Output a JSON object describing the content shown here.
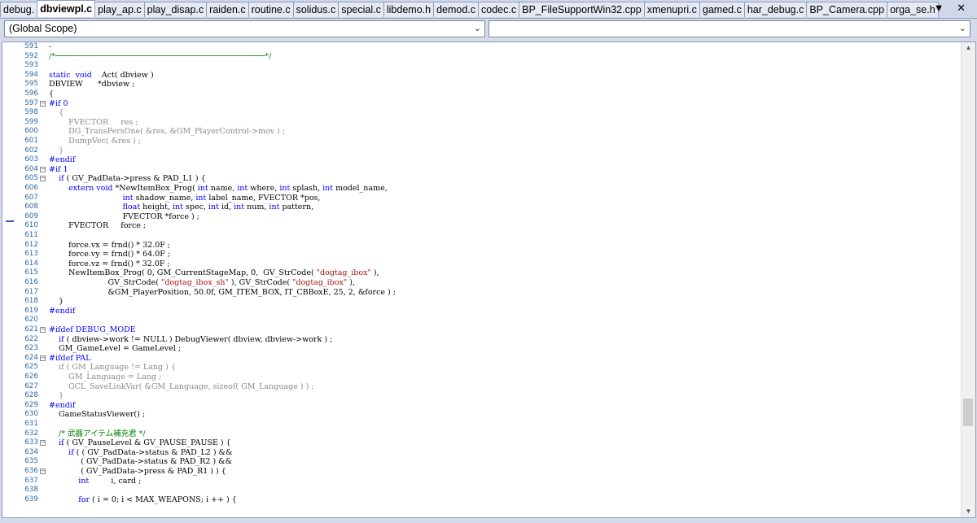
{
  "tabs": [
    {
      "label": "debug.",
      "active": false
    },
    {
      "label": "dbviewpl.c",
      "active": true
    },
    {
      "label": "play_ap.c",
      "active": false
    },
    {
      "label": "play_disap.c",
      "active": false
    },
    {
      "label": "raiden.c",
      "active": false
    },
    {
      "label": "routine.c",
      "active": false
    },
    {
      "label": "solidus.c",
      "active": false
    },
    {
      "label": "special.c",
      "active": false
    },
    {
      "label": "libdemo.h",
      "active": false
    },
    {
      "label": "demod.c",
      "active": false
    },
    {
      "label": "codec.c",
      "active": false
    },
    {
      "label": "BP_FileSupportWin32.cpp",
      "active": false
    },
    {
      "label": "xmenupri.c",
      "active": false
    },
    {
      "label": "gamed.c",
      "active": false
    },
    {
      "label": "har_debug.c",
      "active": false
    },
    {
      "label": "BP_Camera.cpp",
      "active": false
    },
    {
      "label": "orga_se.h",
      "active": false
    }
  ],
  "tab_controls": {
    "dropdown_icon": "▼",
    "close_icon": "✕"
  },
  "scope": {
    "left_value": "(Global Scope)",
    "right_value": ""
  },
  "code_lines": [
    {
      "n": "591",
      "t": "-",
      "fold": ""
    },
    {
      "n": "592",
      "t": "/*─────────────────────────────────────────────*/",
      "fold": "",
      "c": "cm"
    },
    {
      "n": "593",
      "t": "",
      "fold": ""
    },
    {
      "n": "594",
      "t": "static  void    Act( dbview )",
      "fold": "",
      "segs": [
        [
          "static",
          "kw"
        ],
        [
          "  ",
          ""
        ],
        [
          "void",
          "kw"
        ],
        [
          "    Act( dbview )",
          ""
        ]
      ]
    },
    {
      "n": "595",
      "t": "DBVIEW      *dbview ;",
      "fold": ""
    },
    {
      "n": "596",
      "t": "{",
      "fold": ""
    },
    {
      "n": "597",
      "t": "#if 0",
      "fold": "-",
      "c": "pp"
    },
    {
      "n": "598",
      "t": "    {",
      "fold": "",
      "c": "dim"
    },
    {
      "n": "599",
      "t": "        FVECTOR     res ;",
      "fold": "",
      "c": "dim"
    },
    {
      "n": "600",
      "t": "        DG_TransPersOne( &res, &GM_PlayerControl->mov ) ;",
      "fold": "",
      "c": "dim"
    },
    {
      "n": "601",
      "t": "        DumpVec( &res ) ;",
      "fold": "",
      "c": "dim"
    },
    {
      "n": "602",
      "t": "    }",
      "fold": "",
      "c": "dim"
    },
    {
      "n": "603",
      "t": "#endif",
      "fold": "",
      "c": "pp"
    },
    {
      "n": "604",
      "t": "#if 1",
      "fold": "-",
      "c": "pp"
    },
    {
      "n": "605",
      "t": "    if ( GV_PadData->press & PAD_L1 ) {",
      "fold": "-",
      "segs": [
        [
          "    ",
          ""
        ],
        [
          "if",
          "kw"
        ],
        [
          " ( GV_PadData->press & PAD_L1 ) {",
          ""
        ]
      ]
    },
    {
      "n": "606",
      "t": "        extern void *NewItemBox_Prog( int name, int where, int splash, int model_name,",
      "fold": "",
      "segs": [
        [
          "        ",
          ""
        ],
        [
          "extern void",
          "kw"
        ],
        [
          " *NewItemBox_Prog( ",
          ""
        ],
        [
          "int",
          "kw"
        ],
        [
          " name, ",
          ""
        ],
        [
          "int",
          "kw"
        ],
        [
          " where, ",
          ""
        ],
        [
          "int",
          "kw"
        ],
        [
          " splash, ",
          ""
        ],
        [
          "int",
          "kw"
        ],
        [
          " model_name,",
          ""
        ]
      ]
    },
    {
      "n": "607",
      "t": "                              int shadow_name, int label_name, FVECTOR *pos,",
      "fold": "",
      "segs": [
        [
          "                              ",
          ""
        ],
        [
          "int",
          "kw"
        ],
        [
          " shadow_name, ",
          ""
        ],
        [
          "int",
          "kw"
        ],
        [
          " label_name, FVECTOR *pos,",
          ""
        ]
      ]
    },
    {
      "n": "608",
      "t": "                              float height, int spec, int id, int num, int pattern,",
      "fold": "",
      "segs": [
        [
          "                              ",
          ""
        ],
        [
          "float",
          "kw"
        ],
        [
          " height, ",
          ""
        ],
        [
          "int",
          "kw"
        ],
        [
          " spec, ",
          ""
        ],
        [
          "int",
          "kw"
        ],
        [
          " id, ",
          ""
        ],
        [
          "int",
          "kw"
        ],
        [
          " num, ",
          ""
        ],
        [
          "int",
          "kw"
        ],
        [
          " pattern,",
          ""
        ]
      ]
    },
    {
      "n": "609",
      "t": "                              FVECTOR *force ) ;",
      "fold": ""
    },
    {
      "n": "610",
      "t": "        FVECTOR     force ;",
      "fold": ""
    },
    {
      "n": "611",
      "t": "",
      "fold": ""
    },
    {
      "n": "612",
      "t": "        force.vx = frnd() * 32.0F ;",
      "fold": ""
    },
    {
      "n": "613",
      "t": "        force.vy = frnd() * 64.0F ;",
      "fold": ""
    },
    {
      "n": "614",
      "t": "        force.vz = frnd() * 32.0F ;",
      "fold": ""
    },
    {
      "n": "615",
      "t": "        NewItemBox_Prog( 0, GM_CurrentStageMap, 0,  GV_StrCode( \"dogtag_ibox\" ),",
      "fold": "",
      "segs": [
        [
          "        NewItemBox_Prog( 0, GM_CurrentStageMap, 0,  GV_StrCode( ",
          ""
        ],
        [
          "\"dogtag_ibox\"",
          "st"
        ],
        [
          " ),",
          ""
        ]
      ]
    },
    {
      "n": "616",
      "t": "                        GV_StrCode( \"dogtag_ibox_sh\" ), GV_StrCode( \"dogtag_ibox\" ),",
      "fold": "",
      "segs": [
        [
          "                        GV_StrCode( ",
          ""
        ],
        [
          "\"dogtag_ibox_sh\"",
          "st"
        ],
        [
          " ), GV_StrCode( ",
          ""
        ],
        [
          "\"dogtag_ibox\"",
          "st"
        ],
        [
          " ),",
          ""
        ]
      ]
    },
    {
      "n": "617",
      "t": "                        &GM_PlayerPosition, 50.0f, GM_ITEM_BOX, IT_CBBoxE, 25, 2, &force ) ;",
      "fold": ""
    },
    {
      "n": "618",
      "t": "    }",
      "fold": ""
    },
    {
      "n": "619",
      "t": "#endif",
      "fold": "",
      "c": "pp"
    },
    {
      "n": "620",
      "t": "",
      "fold": ""
    },
    {
      "n": "621",
      "t": "#ifdef DEBUG_MODE",
      "fold": "-",
      "c": "pp"
    },
    {
      "n": "622",
      "t": "    if ( dbview->work != NULL ) DebugViewer( dbview, dbview->work ) ;",
      "fold": "",
      "segs": [
        [
          "    ",
          ""
        ],
        [
          "if",
          "kw"
        ],
        [
          " ( dbview->work != NULL ) DebugViewer( dbview, dbview->work ) ;",
          ""
        ]
      ]
    },
    {
      "n": "623",
      "t": "    GM_GameLevel = GameLevel ;",
      "fold": ""
    },
    {
      "n": "624",
      "t": "#ifdef PAL",
      "fold": "-",
      "c": "pp"
    },
    {
      "n": "625",
      "t": "    if ( GM_Language != Lang ) {",
      "fold": "",
      "c": "dim"
    },
    {
      "n": "626",
      "t": "        GM_Language = Lang ;",
      "fold": "",
      "c": "dim"
    },
    {
      "n": "627",
      "t": "        GCL_SaveLinkVar( &GM_Language, sizeof( GM_Language ) ) ;",
      "fold": "",
      "c": "dim"
    },
    {
      "n": "628",
      "t": "    }",
      "fold": "",
      "c": "dim"
    },
    {
      "n": "629",
      "t": "#endif",
      "fold": "",
      "c": "pp"
    },
    {
      "n": "630",
      "t": "    GameStatusViewer() ;",
      "fold": ""
    },
    {
      "n": "631",
      "t": "",
      "fold": ""
    },
    {
      "n": "632",
      "t": "    /* 武器アイテム補充君 */",
      "fold": "",
      "c": "cm"
    },
    {
      "n": "633",
      "t": "    if ( GV_PauseLevel & GV_PAUSE_PAUSE ) {",
      "fold": "-",
      "segs": [
        [
          "    ",
          ""
        ],
        [
          "if",
          "kw"
        ],
        [
          " ( GV_PauseLevel & GV_PAUSE_PAUSE ) {",
          ""
        ]
      ]
    },
    {
      "n": "634",
      "t": "        if ( ( GV_PadData->status & PAD_L2 ) &&",
      "fold": "",
      "segs": [
        [
          "        ",
          ""
        ],
        [
          "if",
          "kw"
        ],
        [
          " ( ( GV_PadData->status & PAD_L2 ) &&",
          ""
        ]
      ]
    },
    {
      "n": "635",
      "t": "             ( GV_PadData->status & PAD_R2 ) &&",
      "fold": ""
    },
    {
      "n": "636",
      "t": "             ( GV_PadData->press & PAD_R1 ) ) {",
      "fold": "-"
    },
    {
      "n": "637",
      "t": "            int         i, card ;",
      "fold": "",
      "segs": [
        [
          "            ",
          ""
        ],
        [
          "int",
          "kw"
        ],
        [
          "         i, card ;",
          ""
        ]
      ]
    },
    {
      "n": "638",
      "t": "",
      "fold": ""
    },
    {
      "n": "639",
      "t": "            for ( i = 0; i < MAX_WEAPONS; i ++ ) {",
      "fold": "",
      "segs": [
        [
          "            ",
          ""
        ],
        [
          "for",
          "kw"
        ],
        [
          " ( i = 0; i < MAX_WEAPONS; i ++ ) {",
          ""
        ]
      ]
    }
  ]
}
